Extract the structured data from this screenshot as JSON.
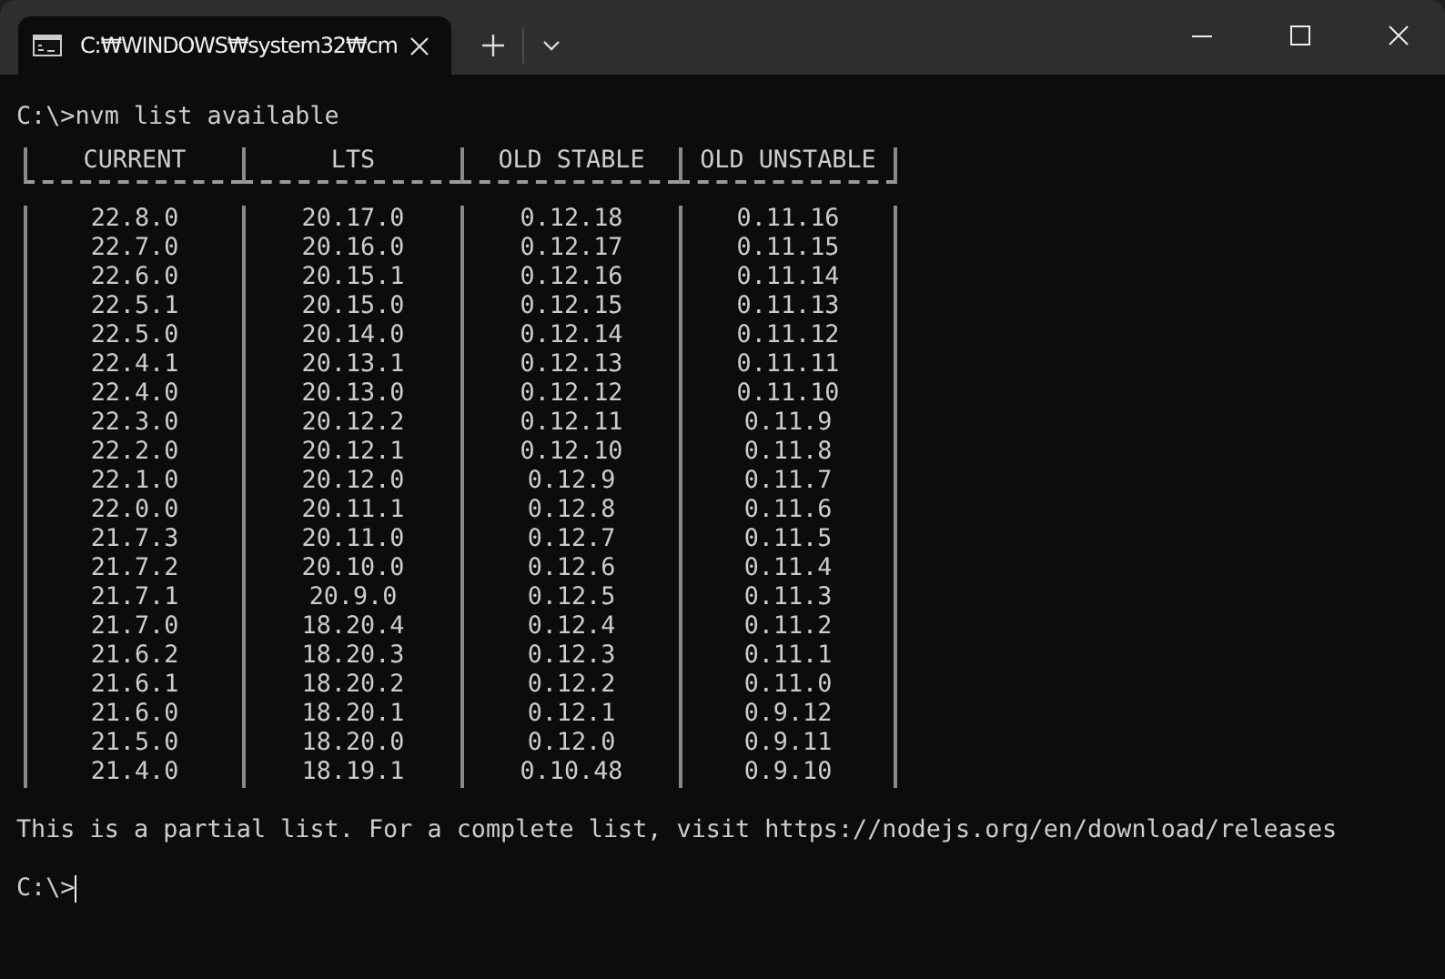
{
  "window": {
    "tab_title": "C:₩WINDOWS₩system32₩cm"
  },
  "terminal": {
    "command_line": "C:\\>nvm list available",
    "table": {
      "columns": [
        "CURRENT",
        "LTS",
        "OLD STABLE",
        "OLD UNSTABLE"
      ],
      "rows": [
        [
          "22.8.0",
          "20.17.0",
          "0.12.18",
          "0.11.16"
        ],
        [
          "22.7.0",
          "20.16.0",
          "0.12.17",
          "0.11.15"
        ],
        [
          "22.6.0",
          "20.15.1",
          "0.12.16",
          "0.11.14"
        ],
        [
          "22.5.1",
          "20.15.0",
          "0.12.15",
          "0.11.13"
        ],
        [
          "22.5.0",
          "20.14.0",
          "0.12.14",
          "0.11.12"
        ],
        [
          "22.4.1",
          "20.13.1",
          "0.12.13",
          "0.11.11"
        ],
        [
          "22.4.0",
          "20.13.0",
          "0.12.12",
          "0.11.10"
        ],
        [
          "22.3.0",
          "20.12.2",
          "0.12.11",
          "0.11.9"
        ],
        [
          "22.2.0",
          "20.12.1",
          "0.12.10",
          "0.11.8"
        ],
        [
          "22.1.0",
          "20.12.0",
          "0.12.9",
          "0.11.7"
        ],
        [
          "22.0.0",
          "20.11.1",
          "0.12.8",
          "0.11.6"
        ],
        [
          "21.7.3",
          "20.11.0",
          "0.12.7",
          "0.11.5"
        ],
        [
          "21.7.2",
          "20.10.0",
          "0.12.6",
          "0.11.4"
        ],
        [
          "21.7.1",
          "20.9.0",
          "0.12.5",
          "0.11.3"
        ],
        [
          "21.7.0",
          "18.20.4",
          "0.12.4",
          "0.11.2"
        ],
        [
          "21.6.2",
          "18.20.3",
          "0.12.3",
          "0.11.1"
        ],
        [
          "21.6.1",
          "18.20.2",
          "0.12.2",
          "0.11.0"
        ],
        [
          "21.6.0",
          "18.20.1",
          "0.12.1",
          "0.9.12"
        ],
        [
          "21.5.0",
          "18.20.0",
          "0.12.0",
          "0.9.11"
        ],
        [
          "21.4.0",
          "18.19.1",
          "0.10.48",
          "0.9.10"
        ]
      ]
    },
    "note": "This is a partial list. For a complete list, visit https://nodejs.org/en/download/releases",
    "prompt": "C:\\>"
  }
}
